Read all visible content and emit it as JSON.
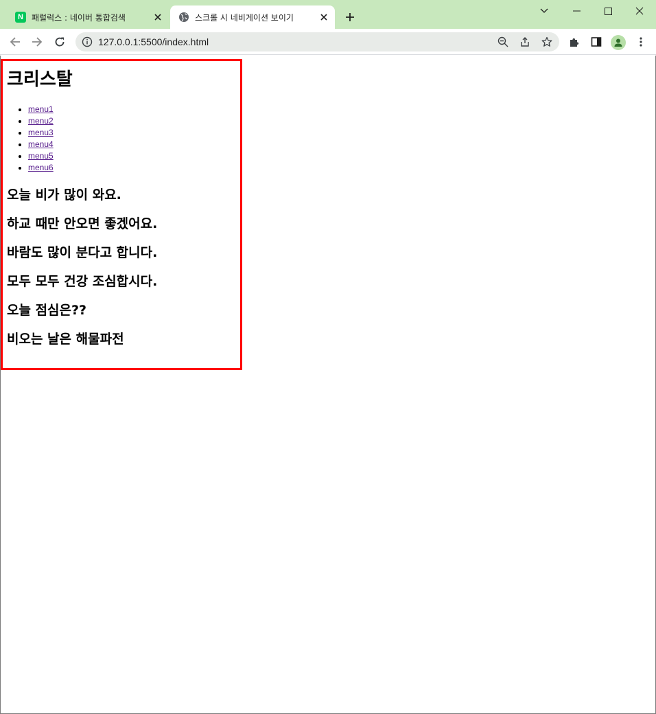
{
  "browser": {
    "tabs": [
      {
        "title": "패럴럭스 : 네이버 통합검색",
        "favicon": "naver-icon",
        "favicon_letter": "N",
        "active": false
      },
      {
        "title": "스크롤 시 네비게이션 보이기",
        "favicon": "globe-icon",
        "active": true
      }
    ],
    "url": "127.0.0.1:5500/index.html"
  },
  "page": {
    "site_title": "크리스탈",
    "menu": [
      "menu1",
      "menu2",
      "menu3",
      "menu4",
      "menu5",
      "menu6"
    ],
    "lines": [
      "오늘 비가 많이 와요.",
      "하교 때만 안오면 좋겠어요.",
      "바람도 많이 분다고 합니다.",
      "모두 모두 건강 조심합시다.",
      "오늘 점심은??",
      "비오는 날은 해물파전"
    ],
    "colors": {
      "border": "#ff0000",
      "visited_link": "#551a8b",
      "tabstrip": "#c8e8bd"
    }
  }
}
